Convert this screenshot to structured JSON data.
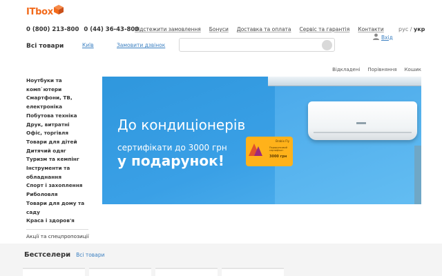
{
  "logo": {
    "text": "ITbox",
    "icon": "cube-icon",
    "brand_color": "#f26a1b"
  },
  "header": {
    "phones": [
      "0 (800) 213-800",
      "0 (44) 36-43-800"
    ],
    "nav": [
      "Відстежити замовлення",
      "Бонуси",
      "Доставка та оплата",
      "Сервіс та гарантія",
      "Контакти"
    ],
    "lang": {
      "inactive": "рус",
      "separator": "/",
      "active": "укр"
    },
    "login": {
      "label": "Вхід",
      "icon": "user-icon"
    }
  },
  "subheader": {
    "all_goods": "Всі товари",
    "city": "Київ",
    "callback": "Замовити дзвінок",
    "search": {
      "placeholder": "",
      "button_icon": "search-icon"
    }
  },
  "mini_links": [
    "Відкладені",
    "Порівняння",
    "Кошик"
  ],
  "sidebar": {
    "categories": [
      "Ноутбуки та комп`ютери",
      "Смартфони, ТВ, електроніка",
      "Побутова техніка",
      "Друк, витратні",
      "Офіс, торгівля",
      "Товари для дітей",
      "Дитячий одяг",
      "Туризм та кемпінг",
      "Інструменти та обладнання",
      "Спорт і захоплення",
      "Риболовля",
      "Товари для дому та саду",
      "Краса і здоров'я"
    ],
    "promo": "Акції та спецпропозиції"
  },
  "banner": {
    "line1": "До кондиціонерів",
    "line2": "сертифікати до 3000 грн",
    "line3": "у подарунок!",
    "card": {
      "brand": "Brabix Fly",
      "text": "Подарунковий сертифікат",
      "amount": "3000 грн"
    },
    "colors": {
      "background": "#2f97dd",
      "card": "#ffb21a"
    }
  },
  "bestsellers": {
    "title": "Бестселери",
    "all_link": "Всі товари"
  }
}
